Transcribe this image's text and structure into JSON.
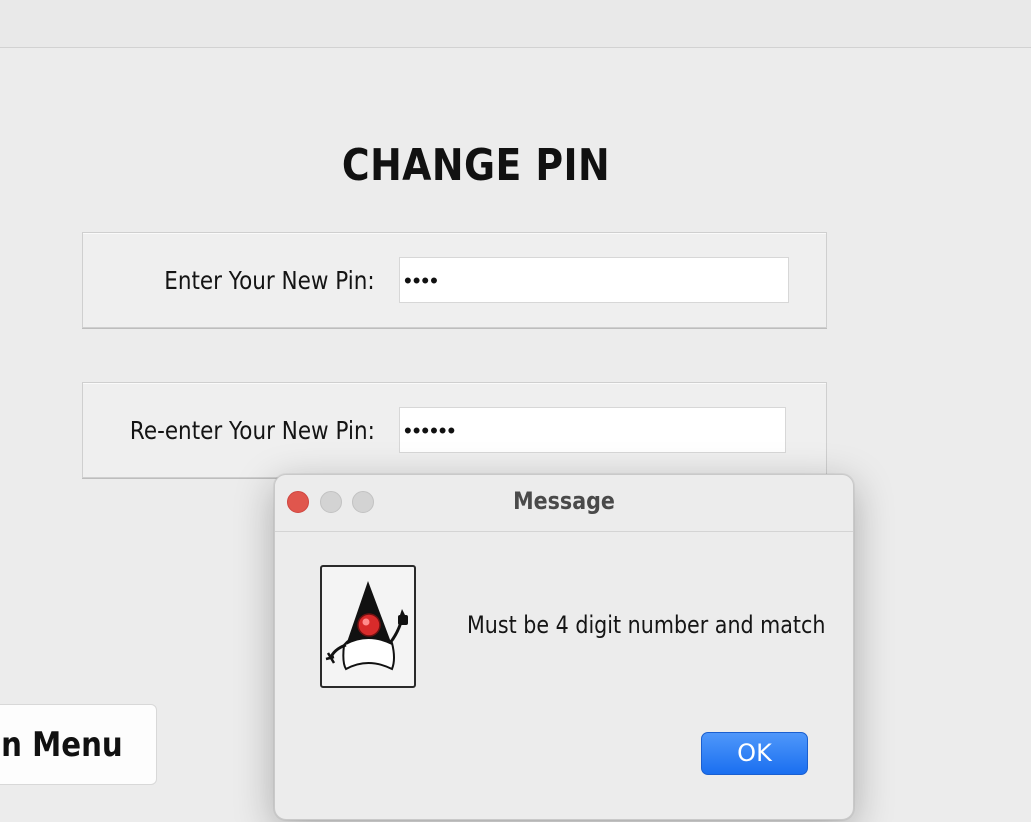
{
  "page": {
    "title": "CHANGE PIN"
  },
  "form": {
    "new_pin_label": "Enter Your New Pin:",
    "new_pin_value": "••••",
    "reenter_pin_label": "Re-enter Your New Pin:",
    "reenter_pin_value": "••••••"
  },
  "menu_button": {
    "label": "on Menu"
  },
  "dialog": {
    "title": "Message",
    "message": "Must be 4 digit number and match",
    "ok_label": "OK",
    "icon": "java-duke-icon"
  },
  "colors": {
    "accent": "#1a6ff0",
    "close": "#e0564d",
    "background": "#ececec"
  }
}
